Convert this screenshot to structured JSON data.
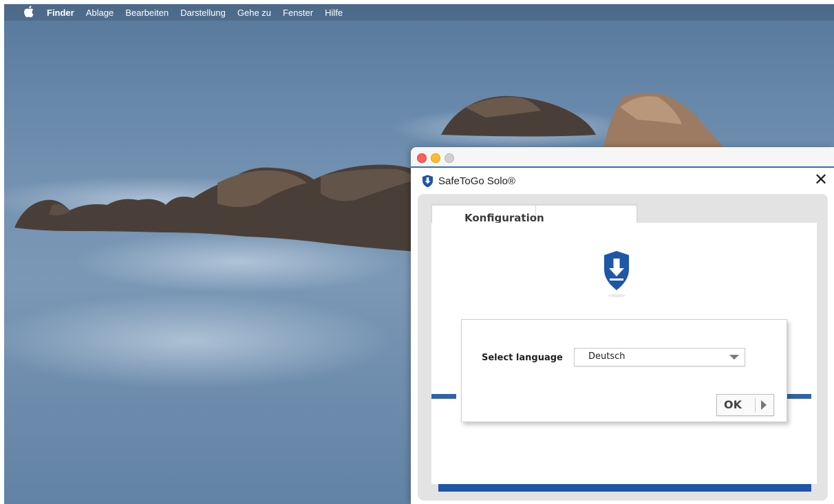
{
  "menubar": {
    "items": [
      {
        "label": "Finder",
        "bold": true
      },
      {
        "label": "Ablage"
      },
      {
        "label": "Bearbeiten"
      },
      {
        "label": "Darstellung"
      },
      {
        "label": "Gehe zu"
      },
      {
        "label": "Fenster"
      },
      {
        "label": "Hilfe"
      }
    ],
    "apple_icon": "apple-icon"
  },
  "window": {
    "title": "SafeToGo Solo®",
    "close_glyph": "✕",
    "tab": {
      "label": "Konfiguration"
    },
    "dialog": {
      "language_label": "Select language",
      "selected_language": "Deutsch",
      "ok_label": "OK"
    }
  },
  "colors": {
    "accent_blue": "#2f63a8",
    "bottom_bar_blue": "#1e56a8",
    "traffic_close": "#fe5f57",
    "traffic_min": "#febc2e"
  }
}
